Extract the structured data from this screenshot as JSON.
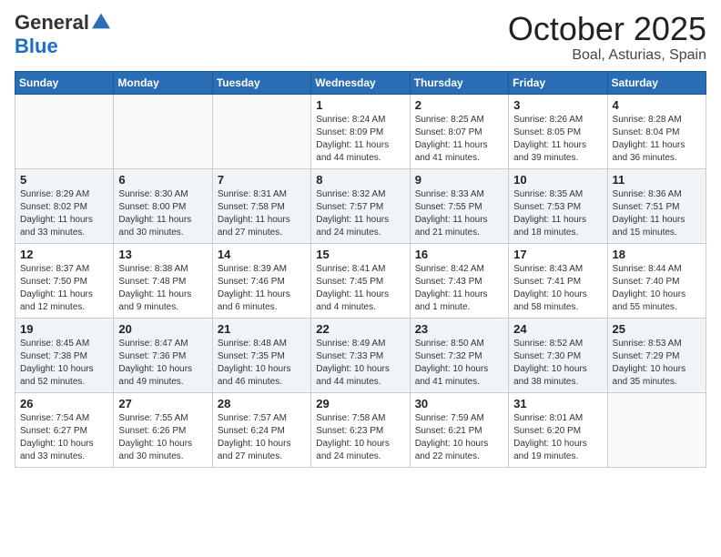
{
  "header": {
    "logo_line1": "General",
    "logo_line2": "Blue",
    "month": "October 2025",
    "location": "Boal, Asturias, Spain"
  },
  "days_of_week": [
    "Sunday",
    "Monday",
    "Tuesday",
    "Wednesday",
    "Thursday",
    "Friday",
    "Saturday"
  ],
  "weeks": [
    [
      {
        "day": "",
        "info": ""
      },
      {
        "day": "",
        "info": ""
      },
      {
        "day": "",
        "info": ""
      },
      {
        "day": "1",
        "info": "Sunrise: 8:24 AM\nSunset: 8:09 PM\nDaylight: 11 hours\nand 44 minutes."
      },
      {
        "day": "2",
        "info": "Sunrise: 8:25 AM\nSunset: 8:07 PM\nDaylight: 11 hours\nand 41 minutes."
      },
      {
        "day": "3",
        "info": "Sunrise: 8:26 AM\nSunset: 8:05 PM\nDaylight: 11 hours\nand 39 minutes."
      },
      {
        "day": "4",
        "info": "Sunrise: 8:28 AM\nSunset: 8:04 PM\nDaylight: 11 hours\nand 36 minutes."
      }
    ],
    [
      {
        "day": "5",
        "info": "Sunrise: 8:29 AM\nSunset: 8:02 PM\nDaylight: 11 hours\nand 33 minutes."
      },
      {
        "day": "6",
        "info": "Sunrise: 8:30 AM\nSunset: 8:00 PM\nDaylight: 11 hours\nand 30 minutes."
      },
      {
        "day": "7",
        "info": "Sunrise: 8:31 AM\nSunset: 7:58 PM\nDaylight: 11 hours\nand 27 minutes."
      },
      {
        "day": "8",
        "info": "Sunrise: 8:32 AM\nSunset: 7:57 PM\nDaylight: 11 hours\nand 24 minutes."
      },
      {
        "day": "9",
        "info": "Sunrise: 8:33 AM\nSunset: 7:55 PM\nDaylight: 11 hours\nand 21 minutes."
      },
      {
        "day": "10",
        "info": "Sunrise: 8:35 AM\nSunset: 7:53 PM\nDaylight: 11 hours\nand 18 minutes."
      },
      {
        "day": "11",
        "info": "Sunrise: 8:36 AM\nSunset: 7:51 PM\nDaylight: 11 hours\nand 15 minutes."
      }
    ],
    [
      {
        "day": "12",
        "info": "Sunrise: 8:37 AM\nSunset: 7:50 PM\nDaylight: 11 hours\nand 12 minutes."
      },
      {
        "day": "13",
        "info": "Sunrise: 8:38 AM\nSunset: 7:48 PM\nDaylight: 11 hours\nand 9 minutes."
      },
      {
        "day": "14",
        "info": "Sunrise: 8:39 AM\nSunset: 7:46 PM\nDaylight: 11 hours\nand 6 minutes."
      },
      {
        "day": "15",
        "info": "Sunrise: 8:41 AM\nSunset: 7:45 PM\nDaylight: 11 hours\nand 4 minutes."
      },
      {
        "day": "16",
        "info": "Sunrise: 8:42 AM\nSunset: 7:43 PM\nDaylight: 11 hours\nand 1 minute."
      },
      {
        "day": "17",
        "info": "Sunrise: 8:43 AM\nSunset: 7:41 PM\nDaylight: 10 hours\nand 58 minutes."
      },
      {
        "day": "18",
        "info": "Sunrise: 8:44 AM\nSunset: 7:40 PM\nDaylight: 10 hours\nand 55 minutes."
      }
    ],
    [
      {
        "day": "19",
        "info": "Sunrise: 8:45 AM\nSunset: 7:38 PM\nDaylight: 10 hours\nand 52 minutes."
      },
      {
        "day": "20",
        "info": "Sunrise: 8:47 AM\nSunset: 7:36 PM\nDaylight: 10 hours\nand 49 minutes."
      },
      {
        "day": "21",
        "info": "Sunrise: 8:48 AM\nSunset: 7:35 PM\nDaylight: 10 hours\nand 46 minutes."
      },
      {
        "day": "22",
        "info": "Sunrise: 8:49 AM\nSunset: 7:33 PM\nDaylight: 10 hours\nand 44 minutes."
      },
      {
        "day": "23",
        "info": "Sunrise: 8:50 AM\nSunset: 7:32 PM\nDaylight: 10 hours\nand 41 minutes."
      },
      {
        "day": "24",
        "info": "Sunrise: 8:52 AM\nSunset: 7:30 PM\nDaylight: 10 hours\nand 38 minutes."
      },
      {
        "day": "25",
        "info": "Sunrise: 8:53 AM\nSunset: 7:29 PM\nDaylight: 10 hours\nand 35 minutes."
      }
    ],
    [
      {
        "day": "26",
        "info": "Sunrise: 7:54 AM\nSunset: 6:27 PM\nDaylight: 10 hours\nand 33 minutes."
      },
      {
        "day": "27",
        "info": "Sunrise: 7:55 AM\nSunset: 6:26 PM\nDaylight: 10 hours\nand 30 minutes."
      },
      {
        "day": "28",
        "info": "Sunrise: 7:57 AM\nSunset: 6:24 PM\nDaylight: 10 hours\nand 27 minutes."
      },
      {
        "day": "29",
        "info": "Sunrise: 7:58 AM\nSunset: 6:23 PM\nDaylight: 10 hours\nand 24 minutes."
      },
      {
        "day": "30",
        "info": "Sunrise: 7:59 AM\nSunset: 6:21 PM\nDaylight: 10 hours\nand 22 minutes."
      },
      {
        "day": "31",
        "info": "Sunrise: 8:01 AM\nSunset: 6:20 PM\nDaylight: 10 hours\nand 19 minutes."
      },
      {
        "day": "",
        "info": ""
      }
    ]
  ]
}
